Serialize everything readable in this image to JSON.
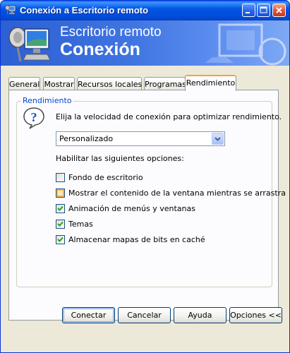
{
  "window": {
    "title": "Conexión a Escritorio remoto"
  },
  "banner": {
    "line1": "Escritorio remoto",
    "line2": "Conexión"
  },
  "tabs": [
    {
      "label": "General"
    },
    {
      "label": "Mostrar"
    },
    {
      "label": "Recursos locales"
    },
    {
      "label": "Programas"
    },
    {
      "label": "Rendimiento",
      "active": true
    }
  ],
  "performance": {
    "group_label": "Rendimiento",
    "speed_prompt": "Elija la velocidad de conexión para optimizar rendimiento.",
    "speed_selected": "Personalizado",
    "options_label": "Habilitar las siguientes opciones:",
    "options": [
      {
        "label": "Fondo de escritorio",
        "checked": false
      },
      {
        "label": "Mostrar el contenido de la ventana mientras se arrastra",
        "checked": false
      },
      {
        "label": "Animación de menús y ventanas",
        "checked": true
      },
      {
        "label": "Temas",
        "checked": true
      },
      {
        "label": "Almacenar mapas de bits en caché",
        "checked": true
      }
    ]
  },
  "buttons": {
    "connect": "Conectar",
    "cancel": "Cancelar",
    "help": "Ayuda",
    "options": "Opciones <<"
  },
  "colors": {
    "titlebar": "#0355e3",
    "accent_tab": "#f0a636",
    "group_label": "#0046d5",
    "dialog_bg": "#ece9d8"
  },
  "icons": {
    "title": "remote-desktop-icon",
    "banner": "remote-desktop-icon",
    "info": "question-balloon-icon"
  }
}
